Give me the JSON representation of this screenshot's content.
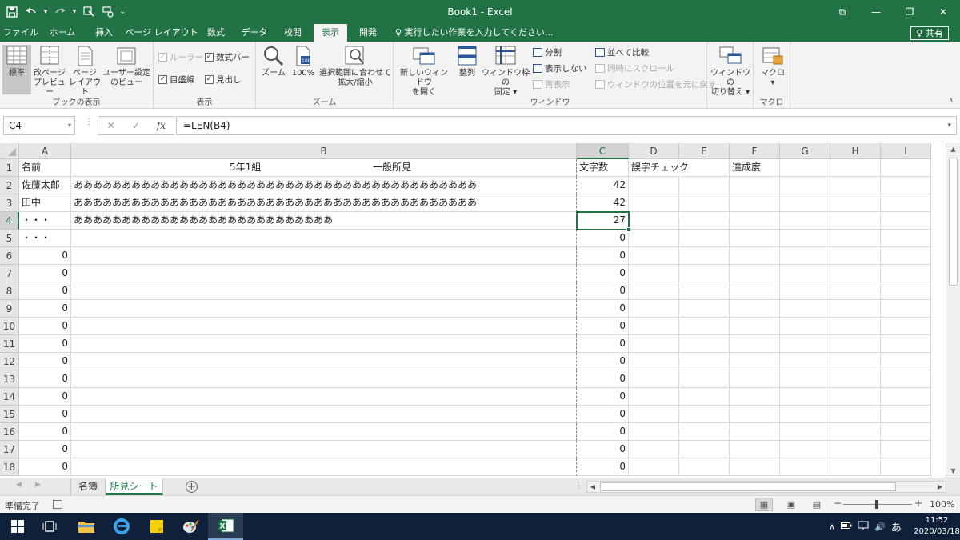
{
  "window": {
    "title": "Book1 - Excel",
    "restore_glyph": "⧉",
    "minimize_glyph": "—",
    "maximize_glyph": "❐",
    "close_glyph": "✕"
  },
  "qat": {
    "save_icon": "save-icon",
    "undo_icon": "undo-icon",
    "redo_icon": "redo-icon",
    "touch_icon": "touch-mode-icon",
    "customize_glyph": "⌄"
  },
  "tabs": [
    {
      "label": "ファイル"
    },
    {
      "label": "ホーム"
    },
    {
      "label": "挿入"
    },
    {
      "label": "ページ レイアウト"
    },
    {
      "label": "数式"
    },
    {
      "label": "データ"
    },
    {
      "label": "校閲"
    },
    {
      "label": "表示"
    },
    {
      "label": "開発"
    }
  ],
  "tellme": "♀ 実行したい作業を入力してください...",
  "share": "♀ 共有",
  "ribbon": {
    "book_views": {
      "label": "ブックの表示",
      "normal": "標準",
      "page_break_1": "改ページ",
      "page_break_2": "プレビュー",
      "page_layout_1": "ページ",
      "page_layout_2": "レイアウト",
      "custom_views_1": "ユーザー設定",
      "custom_views_2": "のビュー"
    },
    "show": {
      "label": "表示",
      "ruler": "ルーラー",
      "formula_bar": "数式バー",
      "gridlines": "目盛線",
      "headings": "見出し"
    },
    "zoom": {
      "label": "ズーム",
      "zoom": "ズーム",
      "hundred": "100%",
      "zoom_sel_1": "選択範囲に合わせて",
      "zoom_sel_2": "拡大/縮小"
    },
    "window": {
      "label": "ウィンドウ",
      "new_window_1": "新しいウィンドウ",
      "new_window_2": "を開く",
      "arrange": "整列",
      "freeze_1": "ウィンドウ枠の",
      "freeze_2": "固定 ▾",
      "split": "分割",
      "hide": "表示しない",
      "unhide": "再表示",
      "side_by_side": "並べて比較",
      "sync_scroll": "同時にスクロール",
      "reset_pos": "ウィンドウの位置を元に戻す",
      "switch_1": "ウィンドウの",
      "switch_2": "切り替え ▾"
    },
    "macros": {
      "label": "マクロ",
      "macros": "マクロ",
      "dd": "▾"
    }
  },
  "formula_bar": {
    "name_box": "C4",
    "formula": "=LEN(B4)",
    "cancel": "✕",
    "enter": "✓",
    "fx": "fx",
    "dots": "⋮",
    "dd": "▾"
  },
  "columns": [
    "A",
    "B",
    "C",
    "D",
    "E",
    "F",
    "G",
    "H",
    "I"
  ],
  "rows": [
    {
      "num": "1",
      "a": "名前",
      "b1": "5年1組",
      "b2": "一般所見",
      "c": "文字数",
      "d": "誤字チェック",
      "f": "達成度"
    },
    {
      "num": "2",
      "a": "佐藤太郎",
      "b": "ああああああああああああああああああああああああああああああああああああああああああ",
      "c": "42"
    },
    {
      "num": "3",
      "a": "田中",
      "b": "ああああああああああああああああああああああああああああああああああああああああああ",
      "c": "42"
    },
    {
      "num": "4",
      "a": "・・・",
      "b": "あああああああああああああああああああああああああああ",
      "c": "27"
    },
    {
      "num": "5",
      "a": "・・・",
      "c": "0"
    },
    {
      "num": "6",
      "a": "0",
      "c": "0"
    },
    {
      "num": "7",
      "a": "0",
      "c": "0"
    },
    {
      "num": "8",
      "a": "0",
      "c": "0"
    },
    {
      "num": "9",
      "a": "0",
      "c": "0"
    },
    {
      "num": "10",
      "a": "0",
      "c": "0"
    },
    {
      "num": "11",
      "a": "0",
      "c": "0"
    },
    {
      "num": "12",
      "a": "0",
      "c": "0"
    },
    {
      "num": "13",
      "a": "0",
      "c": "0"
    },
    {
      "num": "14",
      "a": "0",
      "c": "0"
    },
    {
      "num": "15",
      "a": "0",
      "c": "0"
    },
    {
      "num": "16",
      "a": "0",
      "c": "0"
    },
    {
      "num": "17",
      "a": "0",
      "c": "0"
    },
    {
      "num": "18",
      "a": "0",
      "c": "0"
    }
  ],
  "sheets": [
    {
      "label": "名簿"
    },
    {
      "label": "所見シート"
    }
  ],
  "sheet_nav": {
    "prev": "◀",
    "next": "▶",
    "add": "+",
    "split": "⋮",
    "left": "◀",
    "right": "▶"
  },
  "status": {
    "ready": "準備完了",
    "zoom_pct": "100%",
    "zoom_minus": "−",
    "zoom_plus": "+"
  },
  "taskbar": {
    "time": "11:52",
    "date": "2020/03/18",
    "ime": "あ",
    "tray_up": "∧",
    "volume": "🔊"
  },
  "colors": {
    "excel_green": "#217346",
    "taskbar": "#10203a"
  }
}
